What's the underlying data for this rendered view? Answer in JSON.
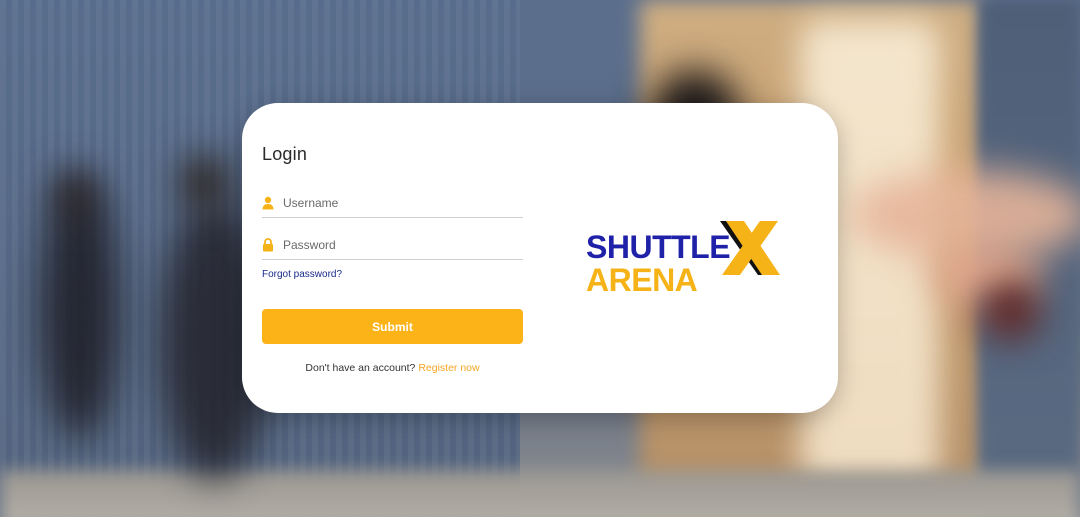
{
  "login": {
    "title": "Login",
    "username_placeholder": "Username",
    "password_placeholder": "Password",
    "forgot_label": "Forgot password?",
    "submit_label": "Submit",
    "no_account_text": "Don't have an account?",
    "register_label": "Register now"
  },
  "brand": {
    "line1": "SHUTTLE",
    "line2": "ARENA",
    "mark": "X",
    "primary_color": "#1f21a8",
    "accent_color": "#f6b318"
  },
  "icons": {
    "username": "user-icon",
    "password": "lock-icon"
  }
}
